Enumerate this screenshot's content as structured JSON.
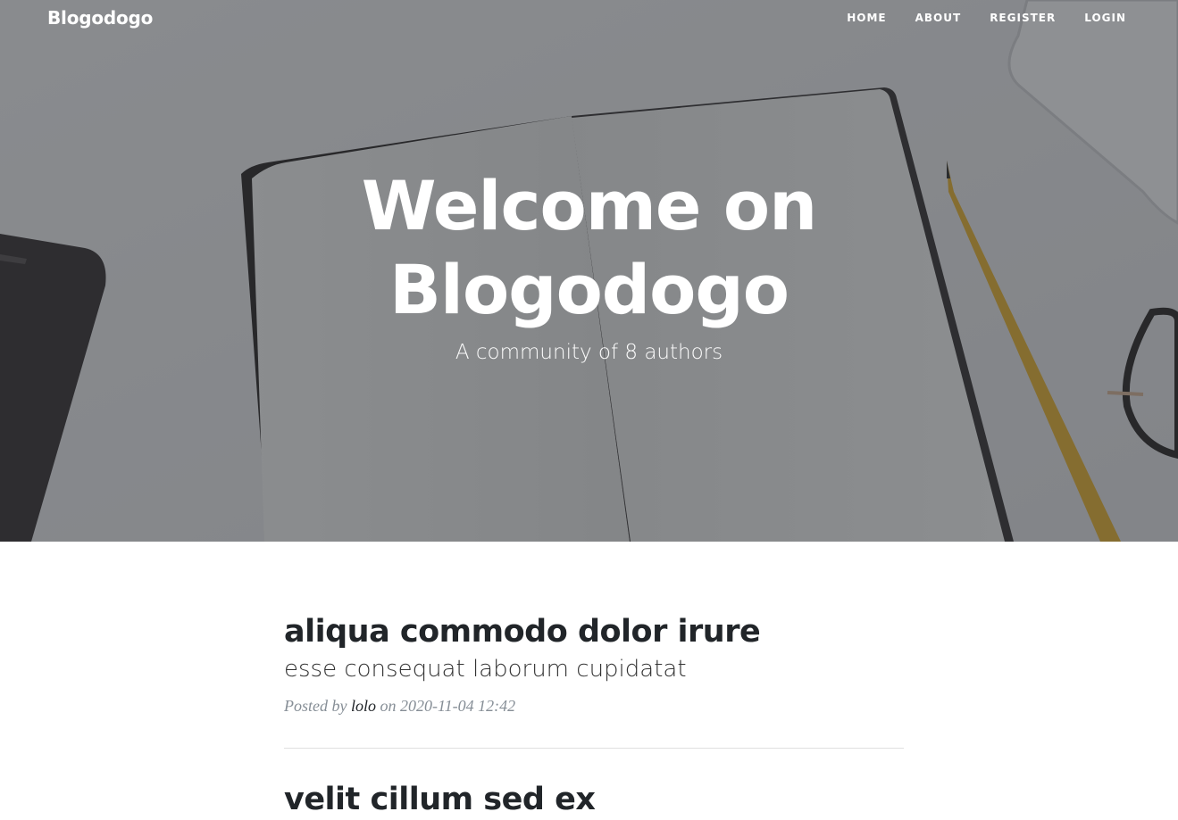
{
  "nav": {
    "brand": "Blogodogo",
    "links": [
      "Home",
      "About",
      "Register",
      "Login"
    ]
  },
  "hero": {
    "title_line1": "Welcome on",
    "title_line2": "Blogodogo",
    "subtitle": "A community of 8 authors"
  },
  "posts": [
    {
      "title": "aliqua commodo dolor irure",
      "subtitle": "esse consequat laborum cupidatat",
      "posted_by": "Posted by",
      "author": "lolo",
      "on": "on",
      "date": "2020-11-04 12:42"
    },
    {
      "title": "velit cillum sed ex"
    }
  ]
}
